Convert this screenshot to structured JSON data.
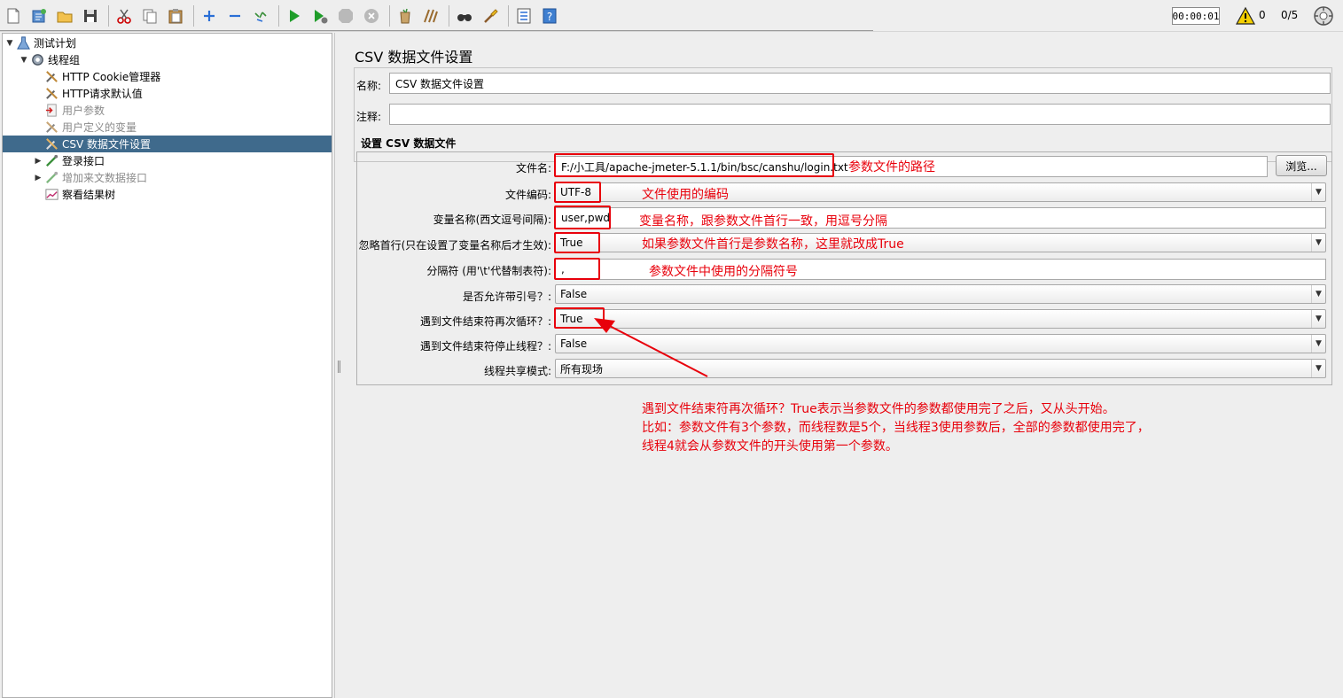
{
  "toolbar": {
    "icons": [
      "new-icon",
      "templates-icon",
      "open-icon",
      "save-icon",
      "cut-icon",
      "copy-icon",
      "paste-icon",
      "expand-icon",
      "collapse-icon",
      "toggle-icon",
      "start-icon",
      "start-no-pause-icon",
      "stop-icon",
      "shutdown-icon",
      "clear-icon",
      "clear-all-icon",
      "search-icon",
      "reset-search-icon",
      "function-helper-icon",
      "help-icon"
    ],
    "timer": "00:00:01",
    "warning_count": "0",
    "threads": "0/5"
  },
  "tree": {
    "items": [
      {
        "label": "测试计划",
        "icon": "test-plan-icon",
        "expanded": true,
        "depth": 0
      },
      {
        "label": "线程组",
        "icon": "thread-group-icon",
        "expanded": true,
        "depth": 1
      },
      {
        "label": "HTTP Cookie管理器",
        "icon": "config-element-icon",
        "depth": 2
      },
      {
        "label": "HTTP请求默认值",
        "icon": "config-element-icon",
        "depth": 2
      },
      {
        "label": "用户参数",
        "icon": "preprocessor-icon",
        "disabled": true,
        "depth": 2
      },
      {
        "label": "用户定义的变量",
        "icon": "config-element-icon",
        "disabled": true,
        "depth": 2
      },
      {
        "label": "CSV 数据文件设置",
        "icon": "config-element-icon",
        "selected": true,
        "depth": 2
      },
      {
        "label": "登录接口",
        "icon": "sampler-icon",
        "collapsed": true,
        "depth": 2
      },
      {
        "label": "增加来文数据接口",
        "icon": "sampler-icon",
        "collapsed": true,
        "disabled": true,
        "depth": 2
      },
      {
        "label": "察看结果树",
        "icon": "listener-icon",
        "depth": 2
      }
    ]
  },
  "panel": {
    "title": "CSV 数据文件设置",
    "name_label": "名称:",
    "name_value": "CSV 数据文件设置",
    "comment_label": "注释:",
    "comment_value": "",
    "group_title": "设置 CSV 数据文件",
    "browse_label": "浏览...",
    "fields": {
      "filename": {
        "label": "文件名:",
        "value": "F:/小工具/apache-jmeter-5.1.1/bin/bsc/canshu/login.txt"
      },
      "encoding": {
        "label": "文件编码:",
        "value": "UTF-8"
      },
      "varnames": {
        "label": "变量名称(西文逗号间隔):",
        "value": "user,pwd"
      },
      "ignore_first": {
        "label": "忽略首行(只在设置了变量名称后才生效):",
        "value": "True"
      },
      "delimiter": {
        "label": "分隔符 (用'\\t'代替制表符):",
        "value": ","
      },
      "quoted": {
        "label": "是否允许带引号？:",
        "value": "False"
      },
      "recycle": {
        "label": "遇到文件结束符再次循环？:",
        "value": "True"
      },
      "stop_thread": {
        "label": "遇到文件结束符停止线程？:",
        "value": "False"
      },
      "share_mode": {
        "label": "线程共享模式:",
        "value": "所有现场"
      }
    }
  },
  "annotations": {
    "filename": "参数文件的路径",
    "encoding": "文件使用的编码",
    "varnames": "变量名称，跟参数文件首行一致，用逗号分隔",
    "ignore_first": "如果参数文件首行是参数名称，这里就改成True",
    "delimiter": "参数文件中使用的分隔符号",
    "note": [
      "遇到文件结束符再次循环？True表示当参数文件的参数都使用完了之后，又从头开始。",
      "比如：参数文件有3个参数，而线程数是5个，当线程3使用参数后，全部的参数都使用完了，",
      "线程4就会从参数文件的开头使用第一个参数。"
    ]
  },
  "colors": {
    "annotation_red": "#e8000b",
    "selection_blue": "#3f6a8c"
  }
}
